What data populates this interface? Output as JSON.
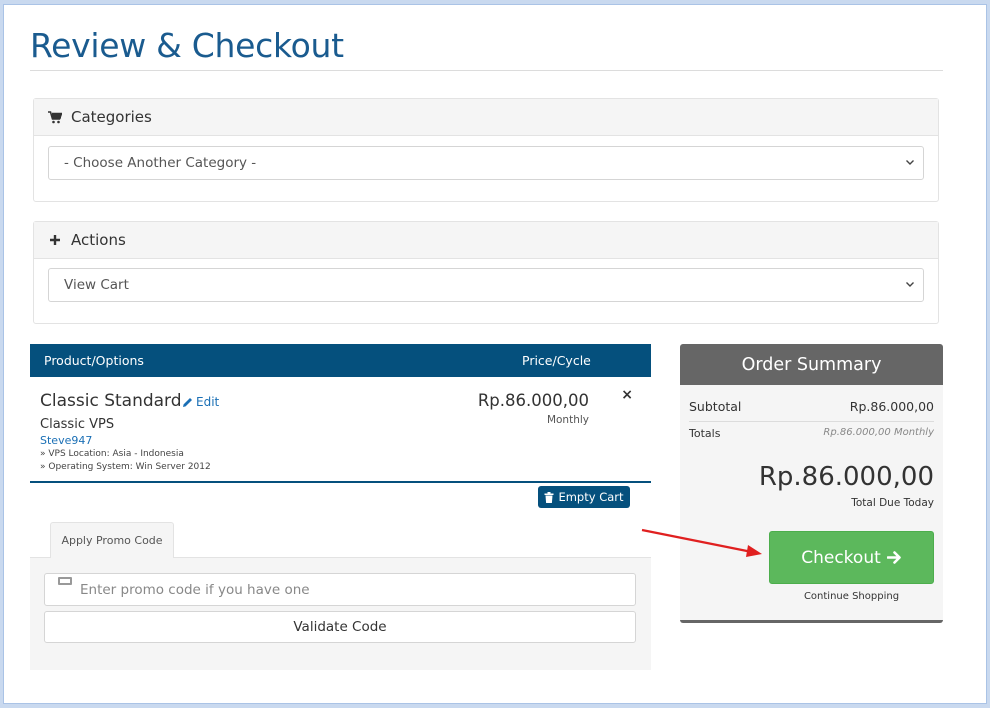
{
  "page": {
    "title": "Review & Checkout"
  },
  "categories": {
    "heading": "Categories",
    "select_value": "- Choose Another Category -"
  },
  "actions": {
    "heading": "Actions",
    "select_value": "View Cart"
  },
  "cart": {
    "col_product": "Product/Options",
    "col_price": "Price/Cycle",
    "item": {
      "name": "Classic Standard",
      "edit_label": "Edit",
      "group": "Classic VPS",
      "hostname": "Steve947",
      "options": [
        "» VPS Location: Asia - Indonesia",
        "» Operating System: Win Server 2012"
      ],
      "price": "Rp.86.000,00",
      "cycle": "Monthly",
      "remove_symbol": "×"
    },
    "empty_label": "Empty Cart"
  },
  "promo": {
    "tab_label": "Apply Promo Code",
    "placeholder": "Enter promo code if you have one",
    "validate_label": "Validate Code"
  },
  "summary": {
    "heading": "Order Summary",
    "subtotal_label": "Subtotal",
    "subtotal_value": "Rp.86.000,00",
    "totals_label": "Totals",
    "totals_value": "Rp.86.000,00 Monthly",
    "total_due": "Rp.86.000,00",
    "total_due_label": "Total Due Today",
    "checkout_label": "Checkout",
    "continue_label": "Continue Shopping"
  },
  "colors": {
    "brand_blue": "#05507d",
    "title_blue": "#1a5b8f",
    "checkout_green": "#5cb85c",
    "summary_grey": "#666666",
    "annotation_arrow": "#e02020"
  },
  "icons": {
    "categories": "cart-icon",
    "actions": "plus-icon",
    "edit": "pencil-icon",
    "empty": "trash-icon",
    "promo": "ticket-icon",
    "checkout": "arrow-right-icon"
  }
}
